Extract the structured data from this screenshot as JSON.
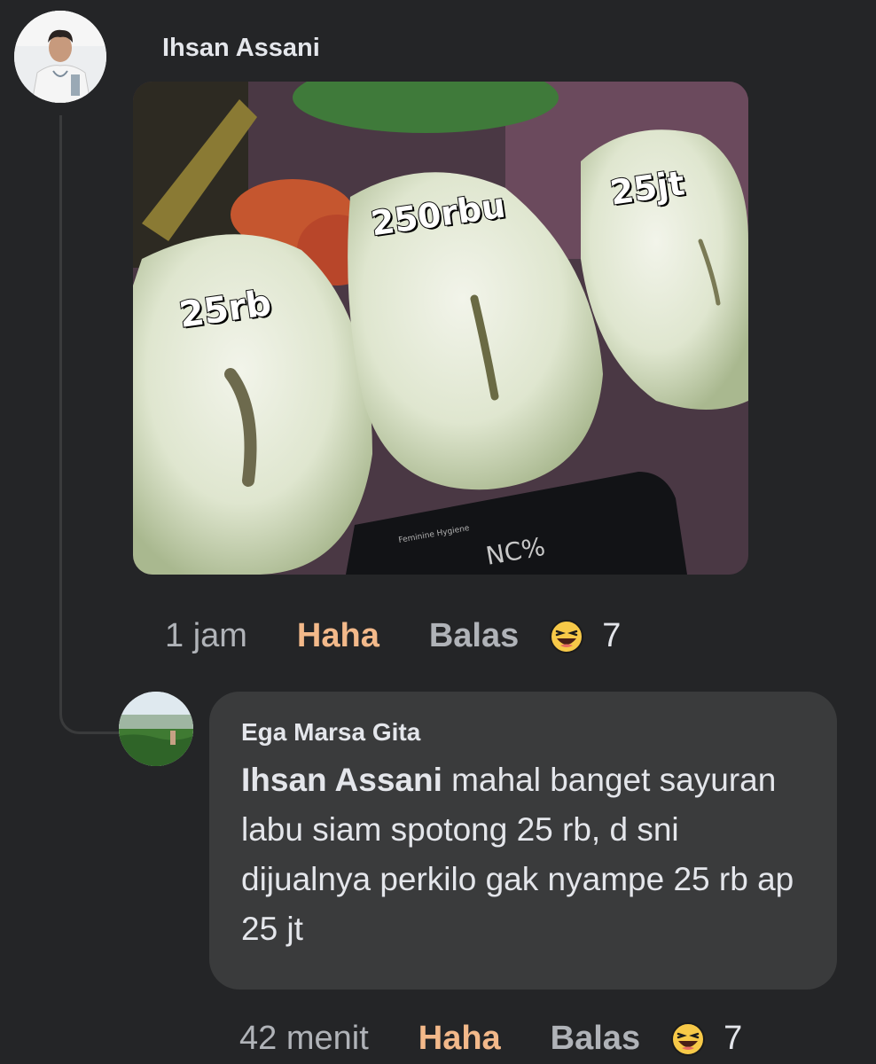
{
  "post_comment": {
    "author": "Ihsan Assani",
    "photo": {
      "labels": [
        "25rb",
        "250rbu",
        "25jt"
      ],
      "product_text": "NC%",
      "product_subtext": "Feminine Hygiene"
    },
    "time": "1 jam",
    "reaction_label": "Haha",
    "reply_label": "Balas",
    "reaction_icon": "haha-emoji-icon",
    "reaction_count": "7"
  },
  "reply_comment": {
    "author": "Ega Marsa Gita",
    "mention": "Ihsan Assani",
    "text": " mahal banget sayuran labu siam spotong 25 rb, d sni dijualnya perkilo gak nyampe 25 rb ap  25 jt",
    "time": "42 menit",
    "reaction_label": "Haha",
    "reply_label": "Balas",
    "reaction_icon": "haha-emoji-icon",
    "reaction_count": "7"
  },
  "colors": {
    "background": "#242527",
    "bubble": "#3a3b3c",
    "haha_text": "#f3b98a",
    "secondary_text": "#b0b3b8",
    "primary_text": "#e4e6eb"
  }
}
